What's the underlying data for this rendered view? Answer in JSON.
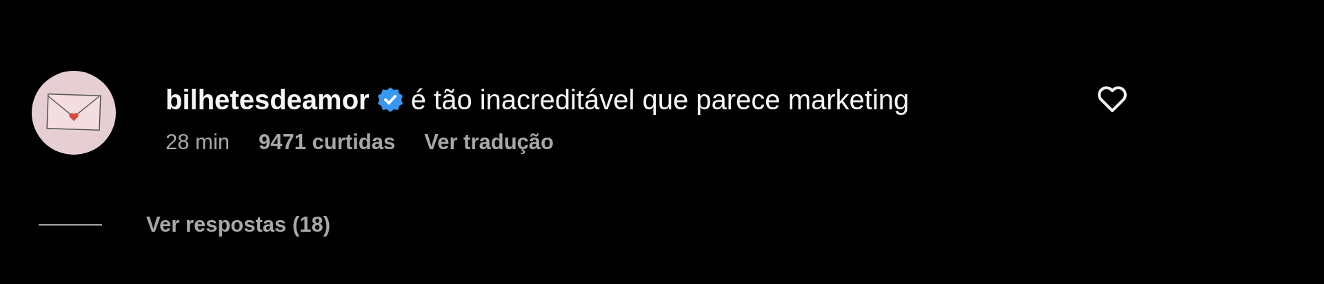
{
  "comment": {
    "username": "bilhetesdeamor",
    "verified": true,
    "text": "é tão inacreditável que parece marketing",
    "time": "28 min",
    "likes": "9471 curtidas",
    "translate": "Ver tradução",
    "liked": false
  },
  "replies": {
    "label": "Ver respostas (18)"
  }
}
